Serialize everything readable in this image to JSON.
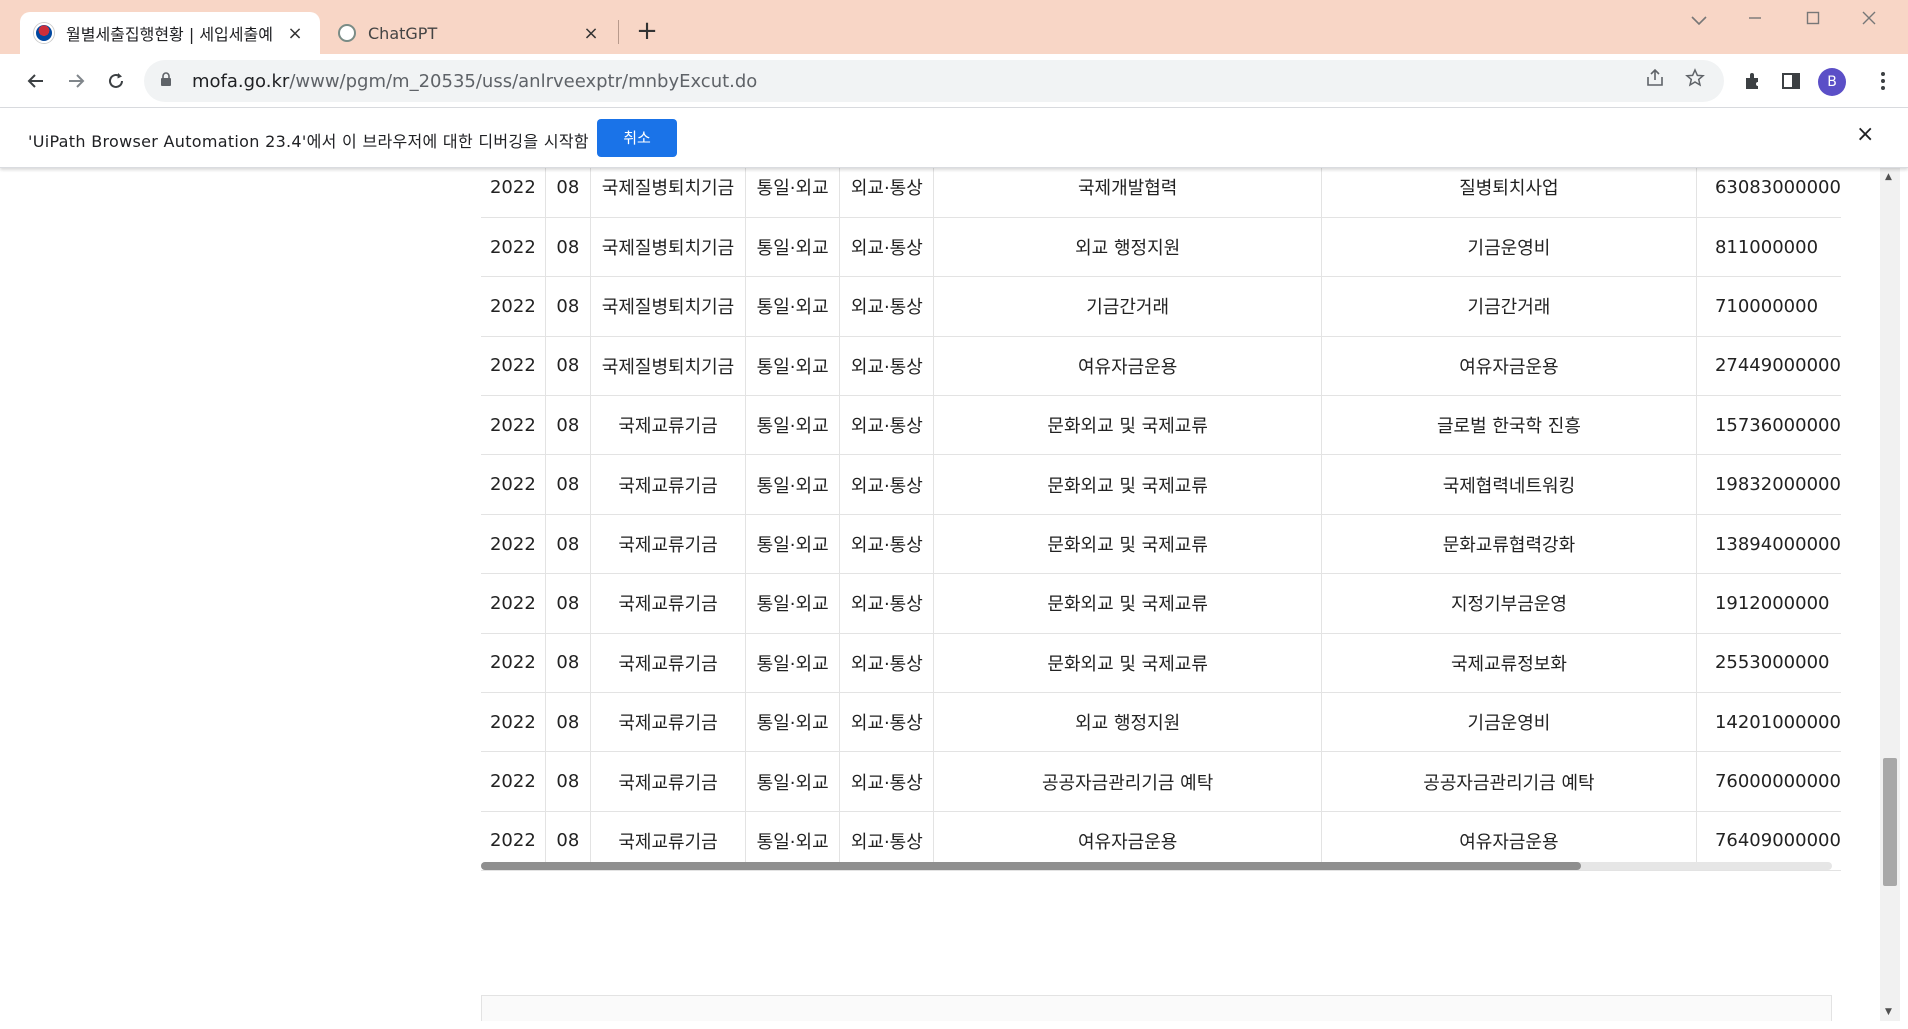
{
  "browser": {
    "tabs": [
      {
        "title": "월별세출집행현황 | 세입세출예",
        "icon": "korea-flag-icon",
        "close": "×"
      },
      {
        "title": "ChatGPT",
        "icon": "chatgpt-icon",
        "close": "×"
      }
    ],
    "new_tab": "+",
    "url_host": "mofa.go.kr",
    "url_path": "/www/pgm/m_20535/uss/anlrveexptr/mnbyExcut.do",
    "profile_initial": "B"
  },
  "infobar": {
    "message": "'UiPath Browser Automation 23.4'에서 이 브라우저에 대한 디버깅을 시작함",
    "cancel_label": "취소",
    "close": "×"
  },
  "table": {
    "rows": [
      [
        "2022",
        "08",
        "국제질병퇴치기금",
        "통일·외교",
        "외교·통상",
        "국제개발협력",
        "질병퇴치사업",
        "63083000000"
      ],
      [
        "2022",
        "08",
        "국제질병퇴치기금",
        "통일·외교",
        "외교·통상",
        "외교 행정지원",
        "기금운영비",
        "811000000"
      ],
      [
        "2022",
        "08",
        "국제질병퇴치기금",
        "통일·외교",
        "외교·통상",
        "기금간거래",
        "기금간거래",
        "710000000"
      ],
      [
        "2022",
        "08",
        "국제질병퇴치기금",
        "통일·외교",
        "외교·통상",
        "여유자금운용",
        "여유자금운용",
        "27449000000"
      ],
      [
        "2022",
        "08",
        "국제교류기금",
        "통일·외교",
        "외교·통상",
        "문화외교 및 국제교류",
        "글로벌 한국학 진흥",
        "15736000000"
      ],
      [
        "2022",
        "08",
        "국제교류기금",
        "통일·외교",
        "외교·통상",
        "문화외교 및 국제교류",
        "국제협력네트워킹",
        "19832000000"
      ],
      [
        "2022",
        "08",
        "국제교류기금",
        "통일·외교",
        "외교·통상",
        "문화외교 및 국제교류",
        "문화교류협력강화",
        "13894000000"
      ],
      [
        "2022",
        "08",
        "국제교류기금",
        "통일·외교",
        "외교·통상",
        "문화외교 및 국제교류",
        "지정기부금운영",
        "1912000000"
      ],
      [
        "2022",
        "08",
        "국제교류기금",
        "통일·외교",
        "외교·통상",
        "문화외교 및 국제교류",
        "국제교류정보화",
        "2553000000"
      ],
      [
        "2022",
        "08",
        "국제교류기금",
        "통일·외교",
        "외교·통상",
        "외교 행정지원",
        "기금운영비",
        "14201000000"
      ],
      [
        "2022",
        "08",
        "국제교류기금",
        "통일·외교",
        "외교·통상",
        "공공자금관리기금 예탁",
        "공공자금관리기금 예탁",
        "76000000000"
      ],
      [
        "2022",
        "08",
        "국제교류기금",
        "통일·외교",
        "외교·통상",
        "여유자금운용",
        "여유자금운용",
        "76409000000"
      ]
    ]
  }
}
